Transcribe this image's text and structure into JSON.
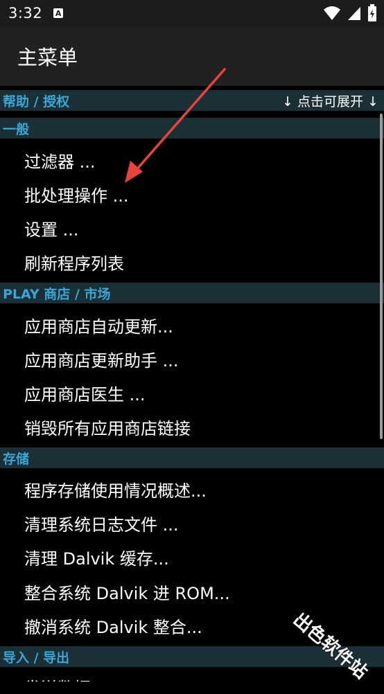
{
  "status_bar": {
    "time": "3:32",
    "notification_icon_letter": "A",
    "icons": [
      "wifi-icon",
      "signal-icon",
      "battery-icon"
    ]
  },
  "app_bar": {
    "title": "主菜单"
  },
  "sections": {
    "help": {
      "label": "帮助 / 授权",
      "hint": "↓ 点击可展开 ↓"
    },
    "general": {
      "label": "一般",
      "items": [
        "过滤器 ...",
        "批处理操作 ...",
        "设置 ...",
        "刷新程序列表"
      ]
    },
    "play": {
      "label": "PLAY 商店 / 市场",
      "items": [
        "应用商店自动更新...",
        "应用商店更新助手 ...",
        "应用商店医生 ...",
        "销毁所有应用商店链接"
      ]
    },
    "storage": {
      "label": "存储",
      "items": [
        "程序存储使用情况概述...",
        "清理系统日志文件 ...",
        "清理 Dalvik 缓存...",
        "整合系统 Dalvik 进 ROM...",
        "撤消系统 Dalvik 整合..."
      ]
    },
    "import_export": {
      "label": "导入 / 导出",
      "items": [
        "发送数据..."
      ]
    }
  },
  "watermark": "出色软件站",
  "colors": {
    "section_header_bg": "#1b2f36",
    "section_header_text": "#3aa6d6",
    "annotation_arrow": "#e8443d"
  }
}
